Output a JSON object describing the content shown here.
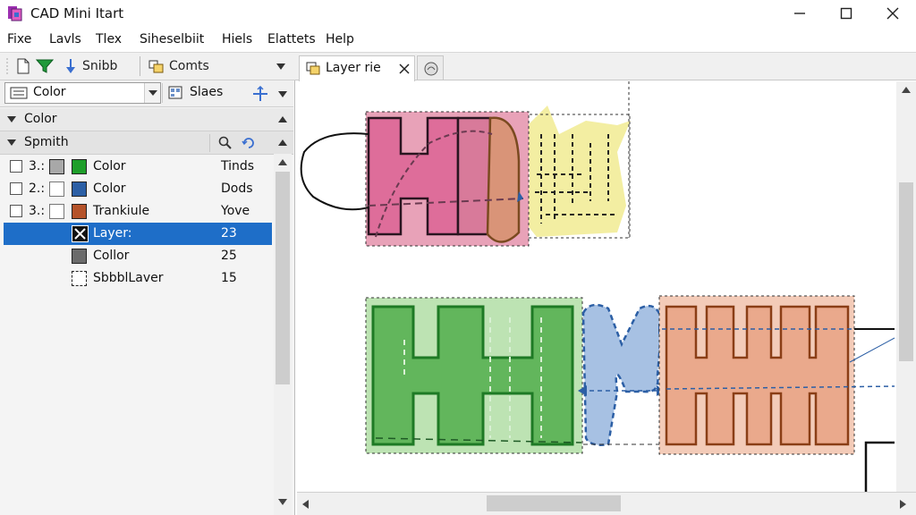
{
  "window": {
    "title": "CAD Mini Itart"
  },
  "menu": [
    "Fixe",
    "Lavls",
    "Tlex",
    "Siheselbiit",
    "Hiels",
    "Elattets",
    "Help"
  ],
  "toolbar": {
    "snap_label": "Snibb",
    "comments_label": "Comts"
  },
  "tab": {
    "label": "Layer rie"
  },
  "panel": {
    "combo_value": "Color",
    "sheets_label": "Slaes",
    "section1": "Color",
    "section2": "Spmith",
    "rows": [
      {
        "num": "3.:",
        "label": "Color",
        "value": "Tinds",
        "color": "#1e9e2a"
      },
      {
        "num": "2.:",
        "label": "Color",
        "value": "Dods",
        "color": "#2c5fa5"
      },
      {
        "num": "3.:",
        "label": "Trankiule",
        "value": "Yove",
        "color": "#b5532a"
      },
      {
        "num": "",
        "label": "Layer:",
        "value": "23",
        "color": "#111111"
      },
      {
        "num": "",
        "label": "Collor",
        "value": "25",
        "color": "#6b6b6b"
      },
      {
        "num": "",
        "label": "SbbblLaver",
        "value": "15",
        "color": "#ffffff"
      }
    ]
  },
  "colors": {
    "selection": "#1e6ec8"
  }
}
